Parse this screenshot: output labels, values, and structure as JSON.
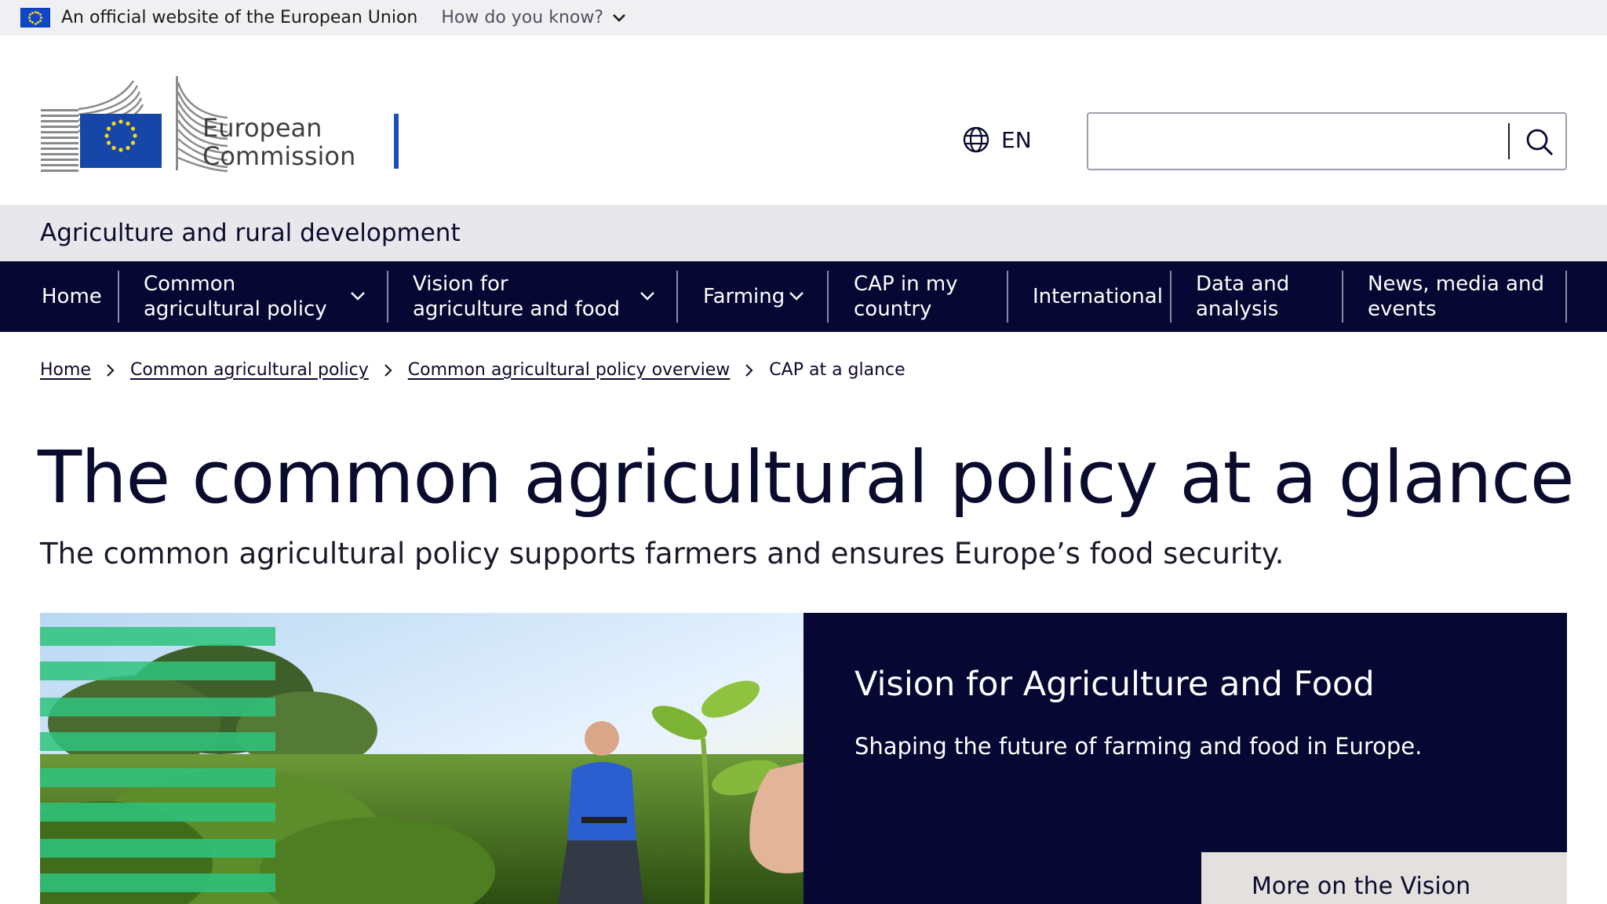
{
  "eu_banner": {
    "official_text": "An official website of the European Union",
    "how_text": "How do you know?"
  },
  "header": {
    "logo_line1": "European",
    "logo_line2": "Commission",
    "language": "EN",
    "search_placeholder": ""
  },
  "site_name": "Agriculture and rural development",
  "menu": [
    {
      "label": "Home",
      "has_dropdown": false
    },
    {
      "label": "Common agricultural policy",
      "has_dropdown": true
    },
    {
      "label": "Vision for agriculture and food",
      "has_dropdown": true
    },
    {
      "label": "Farming",
      "has_dropdown": true
    },
    {
      "label": "CAP in my country",
      "has_dropdown": false
    },
    {
      "label": "International",
      "has_dropdown": false
    },
    {
      "label": "Data and analysis",
      "has_dropdown": false
    },
    {
      "label": "News, media and events",
      "has_dropdown": false
    }
  ],
  "breadcrumb": [
    {
      "label": "Home",
      "link": true
    },
    {
      "label": "Common agricultural policy",
      "link": true
    },
    {
      "label": "Common agricultural policy overview",
      "link": true
    },
    {
      "label": "CAP at a glance",
      "link": false
    }
  ],
  "page": {
    "title": "The common agricultural policy at a glance",
    "subtitle": "The common agricultural policy supports farmers and ensures Europe’s food security."
  },
  "banner": {
    "title": "Vision for Agriculture and Food",
    "description": "Shaping the future of farming and food in Europe.",
    "button_label": "More on the Vision"
  },
  "colors": {
    "primary_dark": "#060733",
    "eu_blue": "#0e47cb",
    "eu_gold": "#ffd617",
    "accent_green": "#2fc47e"
  }
}
